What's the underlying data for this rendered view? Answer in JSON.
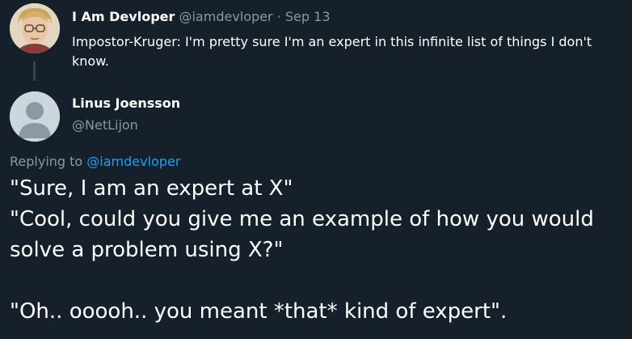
{
  "parent_tweet": {
    "author_name": "I Am Devloper",
    "handle": "@iamdevloper",
    "separator": "·",
    "date": "Sep 13",
    "text": "Impostor-Kruger: I'm pretty sure I'm an expert in this infinite list of things I don't know."
  },
  "reply_tweet": {
    "author_name": "Linus Joensson",
    "handle": "@NetLijon",
    "replying_to_label": "Replying to",
    "replying_to_handle": "@iamdevloper",
    "lines": [
      "\"Sure, I am an expert at X\"",
      "\"Cool, could you give me an example of how you would",
      "solve a problem using X?\"",
      "",
      "\"Oh.. ooooh.. you meant *that* kind of expert\"."
    ]
  },
  "colors": {
    "background": "#15202b",
    "text_primary": "#ffffff",
    "text_secondary": "#8899a6",
    "link": "#1da1f2",
    "thread_line": "#38444d"
  }
}
